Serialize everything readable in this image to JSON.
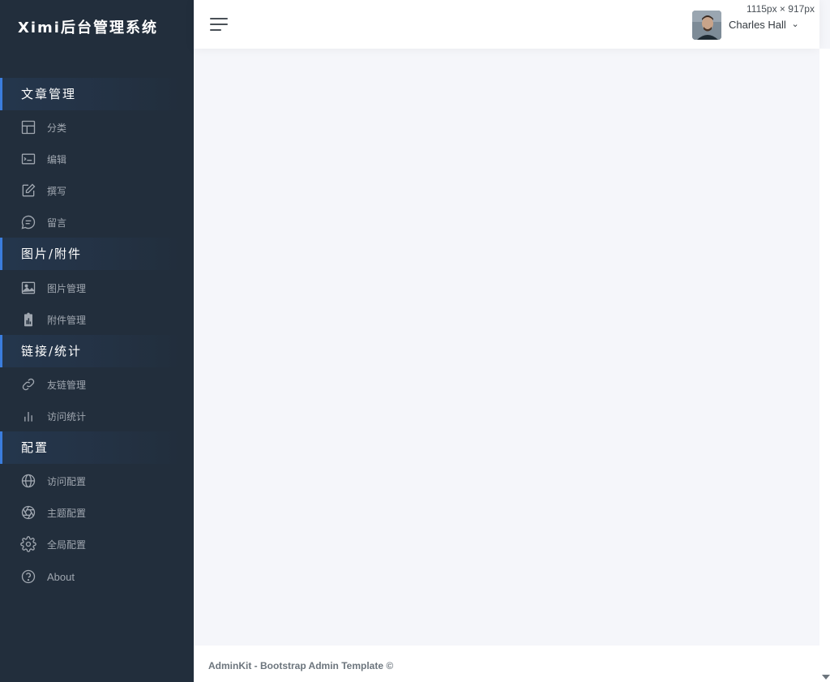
{
  "brand": "Ximi后台管理系统",
  "sidebar": {
    "sections": [
      {
        "title": "文章管理",
        "items": [
          {
            "label": "分类",
            "icon": "layout-icon"
          },
          {
            "label": "编辑",
            "icon": "terminal-icon"
          },
          {
            "label": "撰写",
            "icon": "edit-icon"
          },
          {
            "label": "留言",
            "icon": "message-icon"
          }
        ]
      },
      {
        "title": "图片/附件",
        "items": [
          {
            "label": "图片管理",
            "icon": "image-icon"
          },
          {
            "label": "附件管理",
            "icon": "clipboard-chart-icon"
          }
        ]
      },
      {
        "title": "链接/统计",
        "items": [
          {
            "label": "友链管理",
            "icon": "link-icon"
          },
          {
            "label": "访问统计",
            "icon": "bar-chart-icon"
          }
        ]
      },
      {
        "title": "配置",
        "items": [
          {
            "label": "访问配置",
            "icon": "globe-icon"
          },
          {
            "label": "主题配置",
            "icon": "aperture-icon"
          },
          {
            "label": "全局配置",
            "icon": "settings-icon"
          },
          {
            "label": "About",
            "icon": "help-circle-icon"
          }
        ]
      }
    ]
  },
  "topbar": {
    "user": {
      "name": "Charles Hall",
      "caret": "⌄"
    },
    "dimensions": "1115px × 917px"
  },
  "footer": {
    "text": "AdminKit - Bootstrap Admin Template ©"
  },
  "colors": {
    "sidebar_bg": "#222e3c",
    "accent": "#3b7ddd",
    "content_bg": "#f5f6fa"
  }
}
